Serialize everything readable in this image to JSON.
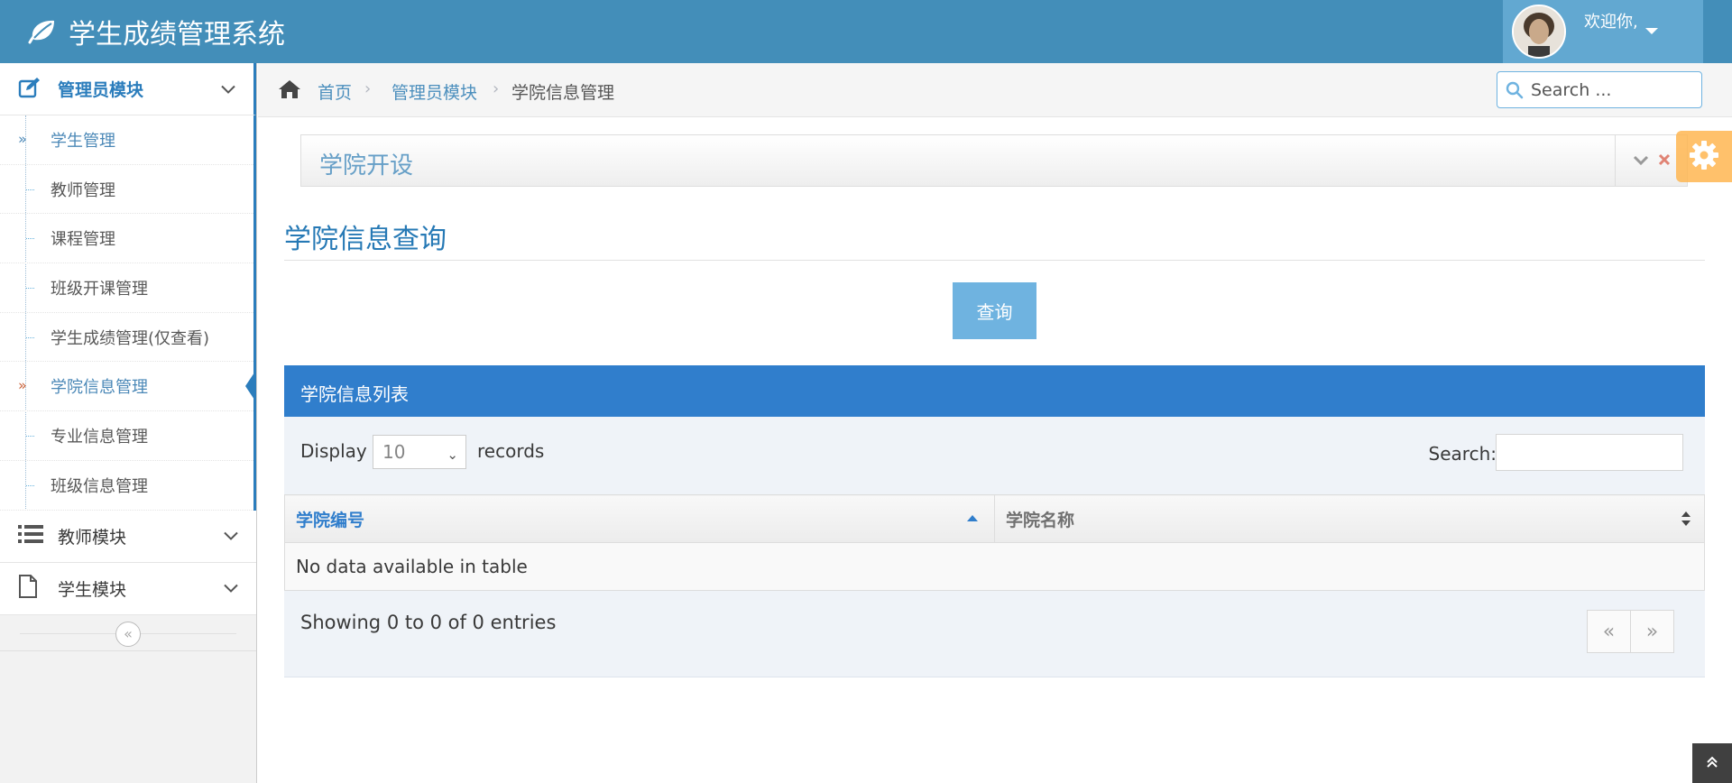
{
  "app": {
    "title": "学生成绩管理系统"
  },
  "user": {
    "welcome": "欢迎你,"
  },
  "sidebar": {
    "modules": [
      {
        "label": "管理员模块",
        "expanded": true,
        "items": [
          {
            "label": "学生管理"
          },
          {
            "label": "教师管理"
          },
          {
            "label": "课程管理"
          },
          {
            "label": "班级开课管理"
          },
          {
            "label": "学生成绩管理(仅查看)"
          },
          {
            "label": "学院信息管理"
          },
          {
            "label": "专业信息管理"
          },
          {
            "label": "班级信息管理"
          }
        ]
      },
      {
        "label": "教师模块",
        "expanded": false
      },
      {
        "label": "学生模块",
        "expanded": false
      }
    ]
  },
  "breadcrumb": {
    "home": "首页",
    "module": "管理员模块",
    "current": "学院信息管理"
  },
  "nav_search": {
    "placeholder": "Search ..."
  },
  "widget": {
    "title": "学院开设"
  },
  "page_header": {
    "title": "学院信息查询"
  },
  "query_button": {
    "label": "查询"
  },
  "table_panel": {
    "title": "学院信息列表",
    "display_label": "Display",
    "page_length": "10",
    "records_label": "records",
    "search_label": "Search:",
    "columns": [
      {
        "label": "学院编号"
      },
      {
        "label": "学院名称"
      }
    ],
    "empty_message": "No data available in table",
    "info": "Showing 0 to 0 of 0 entries",
    "pager": {
      "prev": "«",
      "next": "»"
    }
  },
  "colors": {
    "navbar": "#438eb9",
    "accent": "#307ecc",
    "link": "#4c8fbd",
    "query_button": "#6fb3e0",
    "settings": "#ffb752"
  }
}
